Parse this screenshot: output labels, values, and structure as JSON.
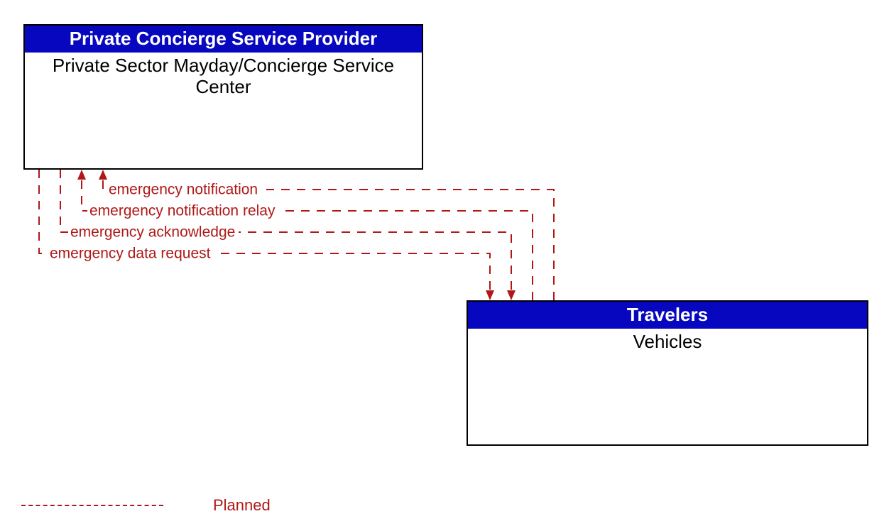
{
  "entities": {
    "provider": {
      "header": "Private Concierge Service Provider",
      "body": "Private Sector Mayday/Concierge Service Center"
    },
    "travelers": {
      "header": "Travelers",
      "body": "Vehicles"
    }
  },
  "flows": {
    "f1": {
      "label": "emergency notification",
      "direction": "vehicles_to_provider"
    },
    "f2": {
      "label": "emergency notification relay",
      "direction": "vehicles_to_provider"
    },
    "f3": {
      "label": "emergency acknowledge",
      "direction": "provider_to_vehicles"
    },
    "f4": {
      "label": "emergency data request",
      "direction": "provider_to_vehicles"
    }
  },
  "legend": {
    "planned": "Planned"
  }
}
